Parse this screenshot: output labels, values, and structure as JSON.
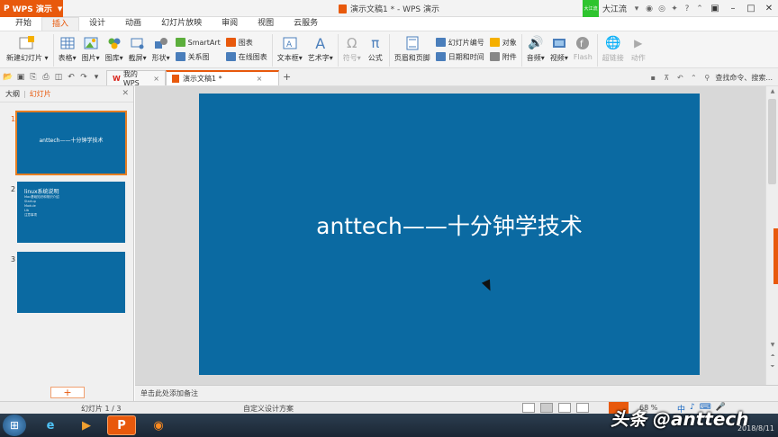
{
  "titlebar": {
    "app_name": "WPS 演示",
    "title": "演示文稿1 * - WPS 演示",
    "user": "大江流",
    "badge": "大江流"
  },
  "menu": {
    "tabs": [
      "开始",
      "插入",
      "设计",
      "动画",
      "幻灯片放映",
      "审阅",
      "视图",
      "云服务"
    ],
    "active": "插入"
  },
  "ribbon": {
    "new_slide": "新建幻灯片",
    "table": "表格",
    "picture": "图片",
    "gallery": "图库",
    "screenshot": "截屏",
    "shapes": "形状",
    "smartart": "SmartArt",
    "chart": "图表",
    "relation": "关系图",
    "online_chart": "在线图表",
    "textbox": "文本框",
    "wordart": "艺术字",
    "symbol": "符号",
    "formula": "公式",
    "header_footer": "页眉和页脚",
    "slide_number": "幻灯片编号",
    "datetime": "日期和时间",
    "object": "对象",
    "attachment": "附件",
    "audio": "音频",
    "video": "视频",
    "flash": "Flash",
    "hyperlink": "超链接",
    "action": "动作"
  },
  "tabs": {
    "mywps": "我的WPS",
    "doc": "演示文稿1 *",
    "search": "查找命令、搜索..."
  },
  "left_panel": {
    "outline": "大纲",
    "slides": "幻灯片",
    "thumbs": [
      {
        "num": "1",
        "title": "anttech——十分钟学技术"
      },
      {
        "num": "2",
        "title": "linux系统说明",
        "items": [
          "Mac基础知识和常识介绍",
          "Startup",
          "Module",
          "Lib",
          "注意事项"
        ]
      },
      {
        "num": "3"
      }
    ],
    "add": "+"
  },
  "slide": {
    "title": "anttech——十分钟学技术"
  },
  "notes": {
    "placeholder": "单击此处添加备注"
  },
  "status": {
    "slide_no": "幻灯片 1 / 3",
    "design": "自定义设计方案",
    "zoom": "68 %"
  },
  "ime": [
    "中",
    "♪",
    "⌨",
    "🎤"
  ],
  "taskbar": {
    "date": "2018/8/11"
  },
  "watermark": "头条 @anttech",
  "colors": {
    "accent": "#e8590c",
    "slide_bg": "#0b6aa2"
  }
}
